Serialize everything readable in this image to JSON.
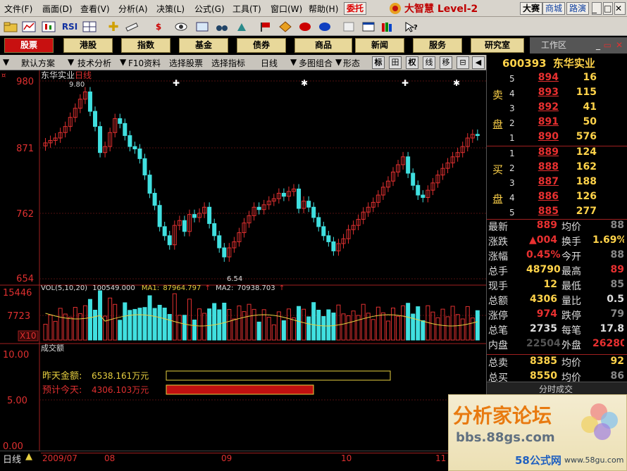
{
  "menu": {
    "items": [
      "文件(F)",
      "画面(D)",
      "查看(V)",
      "分析(A)",
      "决策(L)",
      "公式(G)",
      "工具(T)",
      "窗口(W)",
      "帮助(H)"
    ],
    "commission": "委托",
    "logo": "大智慧 Level-2",
    "right_buttons": [
      "大赛",
      "商城",
      "路演"
    ]
  },
  "toolbar": {
    "rsi": "RSI",
    "dollar": "$"
  },
  "tabs": [
    "股票",
    "港股",
    "指数",
    "基金",
    "债券",
    "商品",
    "新闻",
    "服务",
    "研究室"
  ],
  "workzone": "工作区",
  "subbar": {
    "items": [
      "默认方案",
      "技术分析",
      "F10资料",
      "选择股票",
      "选择指标",
      "日线",
      "多图组合",
      "形态"
    ],
    "buttons": [
      "标",
      "田",
      "权",
      "线",
      "移"
    ]
  },
  "chart": {
    "title": "东华实业",
    "period": "日线",
    "price_ticks": [
      "980",
      "871",
      "762",
      "654"
    ],
    "high_label": "9.80",
    "low_label": "6.54",
    "vol_legend": {
      "name": "VOL(5,10,20)",
      "value": "100549.000",
      "ma1_label": "MA1:",
      "ma1": "87964.797",
      "ma2_label": "MA2:",
      "ma2": "70938.703"
    },
    "vol_ticks": [
      "15446",
      "7723"
    ],
    "vol_unit": "X10",
    "amount_title": "成交额",
    "amount_ticks": [
      "10.00",
      "5.00",
      "0.00"
    ],
    "yesterday_label": "昨天金额:",
    "yesterday_value": "6538.161万元",
    "today_label": "预计今天:",
    "today_value": "4306.103万元",
    "months": [
      "2009/07",
      "08",
      "09",
      "10",
      "11"
    ]
  },
  "chart_data": {
    "type": "candlestick",
    "title": "东华实业 日线",
    "ylim": [
      6.54,
      9.8
    ],
    "close_values": [
      8.78,
      8.82,
      8.86,
      8.95,
      9.05,
      9.2,
      9.35,
      9.5,
      9.62,
      9.3,
      9.05,
      8.62,
      8.72,
      8.95,
      9.18,
      9.1,
      8.9,
      8.72,
      8.68,
      8.52,
      8.25,
      7.95,
      7.75,
      7.4,
      7.25,
      7.1,
      7.42,
      7.5,
      7.32,
      7.6,
      7.55,
      7.62,
      7.72,
      7.45,
      7.25,
      7.05,
      6.9,
      7.05,
      7.15,
      7.3,
      7.46,
      7.58,
      7.72,
      7.68,
      7.76,
      7.82,
      7.86,
      7.95,
      7.9,
      7.98,
      8.02,
      7.7,
      7.82,
      7.72,
      7.55,
      7.4,
      7.25,
      7.15,
      7.0,
      7.12,
      7.2,
      7.35,
      7.42,
      7.52,
      7.64,
      7.72,
      7.8,
      7.92,
      8.05,
      8.15,
      8.3,
      8.42,
      8.55,
      8.28,
      8.08,
      7.92,
      7.88,
      8.0,
      8.12,
      8.25,
      8.36,
      8.45,
      8.55,
      8.62,
      8.72,
      8.86,
      8.92,
      8.9
    ],
    "volume": {
      "ma1": 87964.797,
      "ma2": 70938.703,
      "last": 100549.0,
      "max": 15446
    }
  },
  "orderbook": {
    "code": "600393",
    "name": "东华实业",
    "sell_label_1": "卖",
    "sell_label_2": "盘",
    "buy_label_1": "买",
    "buy_label_2": "盘",
    "sells": [
      {
        "lv": "5",
        "price": "894",
        "vol": "16"
      },
      {
        "lv": "4",
        "price": "893",
        "vol": "115"
      },
      {
        "lv": "3",
        "price": "892",
        "vol": "41"
      },
      {
        "lv": "2",
        "price": "891",
        "vol": "50"
      },
      {
        "lv": "1",
        "price": "890",
        "vol": "576"
      }
    ],
    "buys": [
      {
        "lv": "1",
        "price": "889",
        "vol": "124"
      },
      {
        "lv": "2",
        "price": "888",
        "vol": "162"
      },
      {
        "lv": "3",
        "price": "887",
        "vol": "188"
      },
      {
        "lv": "4",
        "price": "886",
        "vol": "126"
      },
      {
        "lv": "5",
        "price": "885",
        "vol": "277"
      }
    ]
  },
  "stats": [
    {
      "k": "最新",
      "v": "889",
      "vc": "#e83030",
      "k2": "均价",
      "v2": "88",
      "v2c": "#888"
    },
    {
      "k": "涨跌",
      "v": "▲004",
      "vc": "#e83030",
      "k2": "换手",
      "v2": "1.69%",
      "v2c": "#ffd34a"
    },
    {
      "k": "涨幅",
      "v": "0.45%",
      "vc": "#e83030",
      "k2": "今开",
      "v2": "88",
      "v2c": "#888"
    },
    {
      "k": "总手",
      "v": "48790",
      "vc": "#ffd34a",
      "k2": "最高",
      "v2": "89",
      "v2c": "#e83030"
    },
    {
      "k": "现手",
      "v": "12",
      "vc": "#ffd34a",
      "k2": "最低",
      "v2": "85",
      "v2c": "#888"
    },
    {
      "k": "总额",
      "v": "4306",
      "vc": "#ffd34a",
      "k2": "量比",
      "v2": "0.5",
      "v2c": "#ddd"
    },
    {
      "k": "涨停",
      "v": "974",
      "vc": "#e83030",
      "k2": "跌停",
      "v2": "79",
      "v2c": "#888"
    },
    {
      "k": "总笔",
      "v": "2735",
      "vc": "#ddd",
      "k2": "每笔",
      "v2": "17.8",
      "v2c": "#ddd"
    },
    {
      "k": "内盘",
      "v": "22504",
      "vc": "#555",
      "k2": "外盘",
      "v2": "26280",
      "v2c": "#e83030"
    },
    {
      "k": "总卖",
      "v": "8385",
      "vc": "#ffd34a",
      "k2": "均价",
      "v2": "92",
      "v2c": "#ffd34a"
    },
    {
      "k": "总买",
      "v": "8550",
      "vc": "#ffd34a",
      "k2": "均价",
      "v2": "86",
      "v2c": "#888"
    }
  ],
  "tick_header": "分时成交",
  "status": {
    "period": "日线"
  },
  "watermark": {
    "title": "分析家论坛",
    "url": "bbs.88gs.com",
    "site1": "58公式网",
    "site2": "www.58gu.com"
  }
}
